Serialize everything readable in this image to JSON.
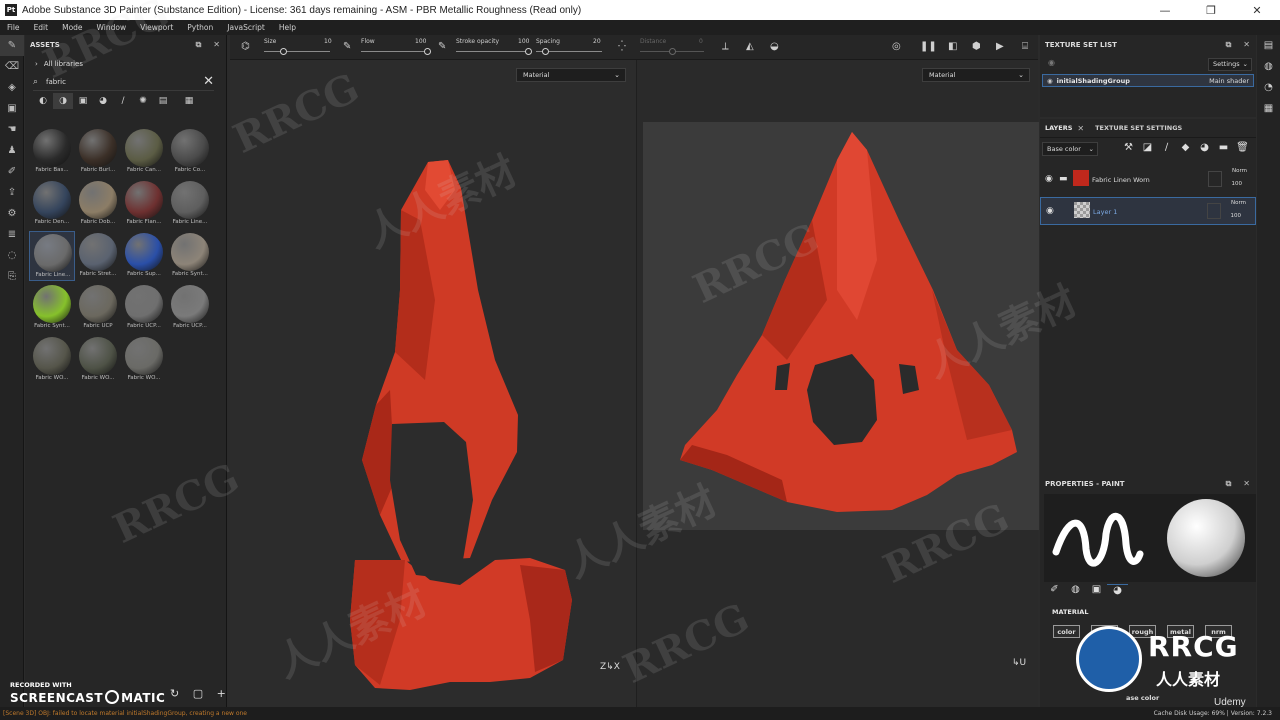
{
  "window": {
    "title": "Adobe Substance 3D Painter (Substance Edition) - License: 361 days remaining - ASM - PBR Metallic Roughness (Read only)",
    "app_icon_text": "Pt",
    "controls": [
      "—",
      "❐",
      "✕"
    ]
  },
  "menu": [
    "File",
    "Edit",
    "Mode",
    "Window",
    "Viewport",
    "Python",
    "JavaScript",
    "Help"
  ],
  "assets": {
    "title": "ASSETS",
    "libraries": "All libraries",
    "search_value": "fabric",
    "tiles": [
      {
        "label": "Fabric Bas...",
        "color": "#2a2a2a"
      },
      {
        "label": "Fabric Burl...",
        "color": "#3b2f27"
      },
      {
        "label": "Fabric Can...",
        "color": "#5b5c44"
      },
      {
        "label": "Fabric Co...",
        "color": "#4a4a4a"
      },
      {
        "label": "Fabric Den...",
        "color": "#34445c"
      },
      {
        "label": "Fabric Dob...",
        "color": "#8c7d66"
      },
      {
        "label": "Fabric Flan...",
        "color": "#6e3030"
      },
      {
        "label": "Fabric Line...",
        "color": "#5e5e5e"
      },
      {
        "label": "Fabric Line...",
        "color": "#6a6a6a"
      },
      {
        "label": "Fabric Stret...",
        "color": "#5a6270"
      },
      {
        "label": "Fabric Sup...",
        "color": "#2a4fa8"
      },
      {
        "label": "Fabric Synt...",
        "color": "#8d8478"
      },
      {
        "label": "Fabric Synt...",
        "color": "#86c12b"
      },
      {
        "label": "Fabric UCP",
        "color": "#6b685e"
      },
      {
        "label": "Fabric UCP...",
        "color": "#6f6f6f"
      },
      {
        "label": "Fabric UCP...",
        "color": "#7a7a7a"
      },
      {
        "label": "Fabric WO...",
        "color": "#55554a"
      },
      {
        "label": "Fabric WO...",
        "color": "#4e5246"
      },
      {
        "label": "Fabric WO...",
        "color": "#6a6a66"
      }
    ]
  },
  "toolbar": {
    "size_label": "Size",
    "size_value": "10",
    "size_level": 0.3,
    "flow_label": "Flow",
    "flow_value": "100",
    "flow_level": 1.0,
    "stroke_opacity_label": "Stroke opacity",
    "stroke_opacity_value": "100",
    "stroke_opacity_level": 1.0,
    "spacing_label": "Spacing",
    "spacing_value": "20",
    "spacing_level": 0.15,
    "distance_label": "Distance",
    "distance_value": "0",
    "distance_level": 0.5
  },
  "viewport3d": {
    "mode": "Material"
  },
  "viewport2d": {
    "mode": "Material"
  },
  "texture_set_list": {
    "title": "TEXTURE SET LIST",
    "settings": "Settings",
    "set_name": "initialShadingGroup",
    "shader": "Main shader"
  },
  "layers": {
    "tab_layers": "LAYERS",
    "tab_tss": "TEXTURE SET SETTINGS",
    "channel": "Base color",
    "items": [
      {
        "name": "Fabric Linen Worn",
        "blend": "Norm",
        "opacity": "100",
        "swatch": "#c0281c"
      },
      {
        "name": "Layer 1",
        "blend": "Norm",
        "opacity": "100",
        "swatch": "#d8d8d8"
      }
    ]
  },
  "properties": {
    "title": "PROPERTIES - PAINT",
    "material_label": "MATERIAL",
    "chips": [
      "color",
      "",
      "rough",
      "metal",
      "nrm"
    ],
    "base_color_label": "ase color"
  },
  "status": {
    "message": "[Scene 3D] OBJ: failed to locate material initialShadingGroup, creating a new one",
    "cache": "Cache Disk Usage:    69% | Version: 7.2.3"
  },
  "overlay": {
    "recorded_with": "RECORDED WITH",
    "brand_left": "SCREENCAST",
    "brand_right": "MATIC",
    "udemy": "Udemy",
    "logo_text": "RRCG",
    "logo_cn": "人人素材",
    "watermark_en": "RRCG",
    "watermark_cn": "人人素材"
  },
  "colors": {
    "hood": "#d13a26",
    "hood_dark": "#9c2416",
    "accent": "#3a6aa0"
  }
}
